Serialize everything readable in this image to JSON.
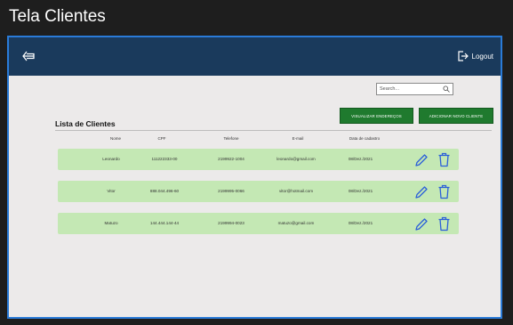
{
  "window": {
    "title": "Tela Clientes"
  },
  "topbar": {
    "logout_label": "Logout"
  },
  "search": {
    "placeholder": "Search..."
  },
  "actions": {
    "address_button_label": "VISUALIZAR ENDEREÇOS",
    "add_client_button_label": "ADICIONAR NOVO CLIENTE"
  },
  "list": {
    "title": "Lista de Clientes",
    "columns": [
      "Nome",
      "CPF",
      "Telefone",
      "E-mail",
      "Data de cadastro"
    ],
    "rows": [
      {
        "nome": "Leonardo",
        "cpf": "111222333-00",
        "telefone": "2199922-1004",
        "email": "leonardo@gmail.com",
        "data": "08/Dez./2021"
      },
      {
        "nome": "Vitor",
        "cpf": "888.044.496-60",
        "telefone": "2199995-0066",
        "email": "vitor@hotmail.com",
        "data": "08/Dez./2021"
      },
      {
        "nome": "Matuzo",
        "cpf": "144.444.144-44",
        "telefone": "2199994-0023",
        "email": "matuzo@gmail.com",
        "data": "08/Dez./2021"
      }
    ]
  },
  "colors": {
    "frame_border": "#2a7bd8",
    "topbar": "#1a3a5c",
    "content_bg": "#eceaea",
    "row_bg": "#c4e8b4",
    "button_green": "#1f7a2e",
    "icon_blue": "#2b5fd9"
  },
  "icons": {
    "back": "arrow-left-icon",
    "logout": "logout-icon",
    "search": "search-icon",
    "edit": "pencil-icon",
    "delete": "trash-icon"
  }
}
